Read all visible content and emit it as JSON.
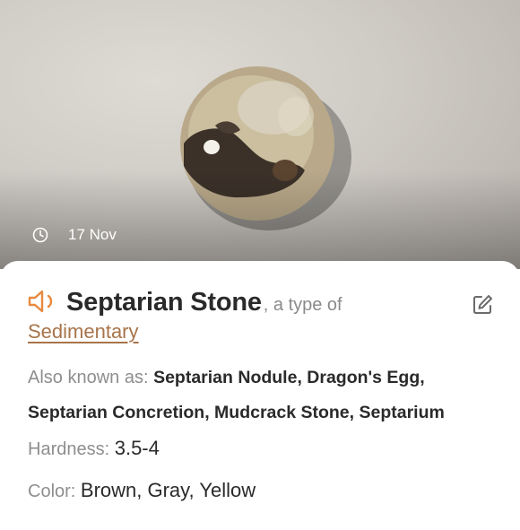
{
  "photo": {
    "date": "17 Nov",
    "clock_icon": "clock-icon"
  },
  "rock": {
    "name": "Septarian Stone",
    "type_of": ", a type of",
    "category": "Sedimentary",
    "speaker_icon": "speaker-icon",
    "edit_icon": "edit-icon",
    "also_known_as_label": "Also known as:",
    "also_known_as_line1": "Septarian Nodule, Dragon's Egg,",
    "also_known_as_line2": "Septarian Concretion, Mudcrack Stone, Septarium",
    "hardness_label": "Hardness:",
    "hardness_value": "3.5-4",
    "color_label": "Color:",
    "color_value": "Brown, Gray, Yellow"
  },
  "colors": {
    "accent": "#E8893F",
    "link": "#A8744A",
    "text_primary": "#2A2A2A",
    "text_secondary": "#8E8E8E"
  }
}
